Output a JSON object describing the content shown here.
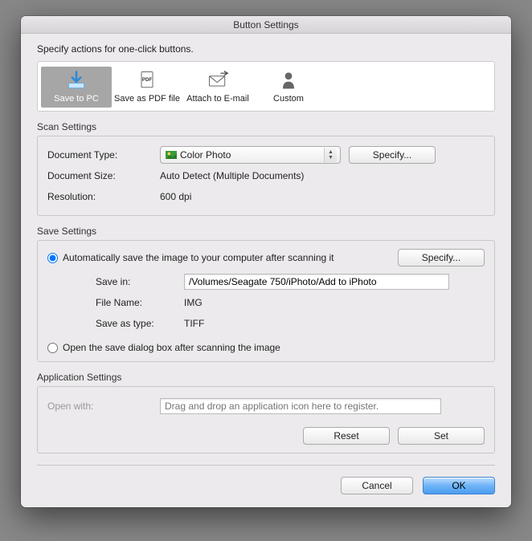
{
  "window": {
    "title": "Button Settings"
  },
  "instruction": "Specify actions for one-click buttons.",
  "actions": {
    "items": [
      {
        "label": "Save to PC"
      },
      {
        "label": "Save as PDF file"
      },
      {
        "label": "Attach to E-mail"
      },
      {
        "label": "Custom"
      }
    ]
  },
  "scanSettings": {
    "heading": "Scan Settings",
    "documentTypeLabel": "Document Type:",
    "documentTypeValue": "Color Photo",
    "specify": "Specify...",
    "documentSizeLabel": "Document Size:",
    "documentSizeValue": "Auto Detect (Multiple Documents)",
    "resolutionLabel": "Resolution:",
    "resolutionValue": "600 dpi"
  },
  "saveSettings": {
    "heading": "Save Settings",
    "autoSaveLabel": "Automatically save the image to your computer after scanning it",
    "specify": "Specify...",
    "saveInLabel": "Save in:",
    "saveInValue": "/Volumes/Seagate 750/iPhoto/Add to iPhoto",
    "fileNameLabel": "File Name:",
    "fileNameValue": "IMG",
    "saveAsTypeLabel": "Save as type:",
    "saveAsTypeValue": "TIFF",
    "dialogLabel": "Open the save dialog box after scanning the image"
  },
  "appSettings": {
    "heading": "Application Settings",
    "openWithLabel": "Open with:",
    "placeholder": "Drag and drop an application icon here to register.",
    "reset": "Reset",
    "set": "Set"
  },
  "footer": {
    "cancel": "Cancel",
    "ok": "OK"
  }
}
